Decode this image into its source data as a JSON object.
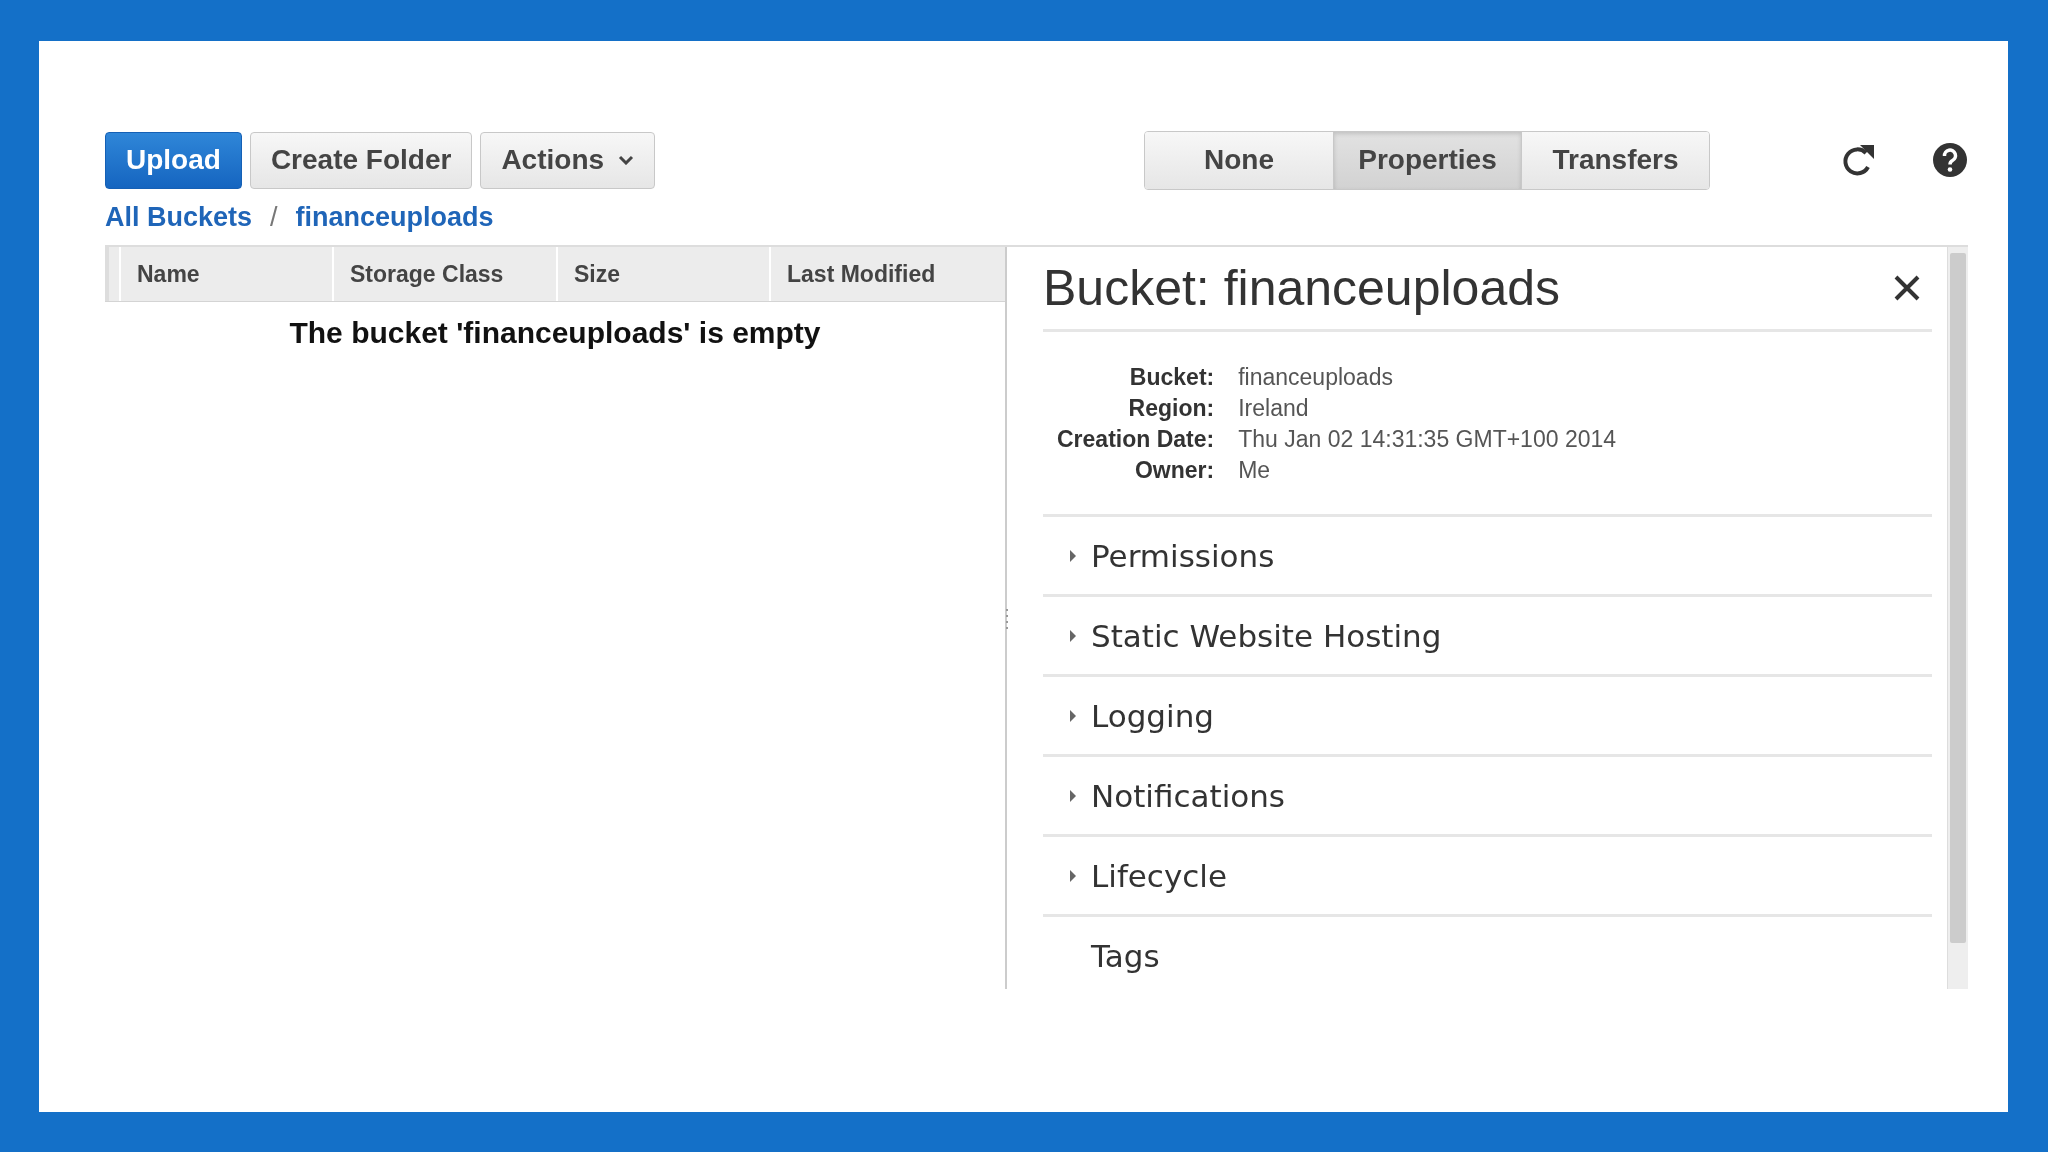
{
  "toolbar": {
    "buttons": [
      {
        "label": "Upload",
        "kind": "primary"
      },
      {
        "label": "Create Folder",
        "kind": "plain"
      },
      {
        "label": "Actions",
        "kind": "dropdown"
      }
    ],
    "view_tabs": [
      {
        "label": "None",
        "selected": false
      },
      {
        "label": "Properties",
        "selected": true
      },
      {
        "label": "Transfers",
        "selected": false
      }
    ]
  },
  "breadcrumb": {
    "links": [
      "All Buckets",
      "financeuploads"
    ],
    "separator": "/"
  },
  "table": {
    "columns": [
      "Name",
      "Storage Class",
      "Size",
      "Last Modified"
    ],
    "empty_message": "The bucket 'financeuploads' is empty"
  },
  "properties": {
    "title": "Bucket: financeuploads",
    "fields": [
      {
        "label": "Bucket:",
        "value": "financeuploads"
      },
      {
        "label": "Region:",
        "value": "Ireland"
      },
      {
        "label": "Creation Date:",
        "value": "Thu Jan 02 14:31:35 GMT+100 2014"
      },
      {
        "label": "Owner:",
        "value": "Me"
      }
    ],
    "sections": [
      {
        "label": "Permissions",
        "kind": "collapsible",
        "expanded": false
      },
      {
        "label": "Static Website Hosting",
        "kind": "collapsible",
        "expanded": false
      },
      {
        "label": "Logging",
        "kind": "collapsible",
        "expanded": false
      },
      {
        "label": "Notifications",
        "kind": "collapsible",
        "expanded": false
      },
      {
        "label": "Lifecycle",
        "kind": "collapsible",
        "expanded": false
      },
      {
        "label": "Tags",
        "kind": "plain"
      }
    ]
  }
}
